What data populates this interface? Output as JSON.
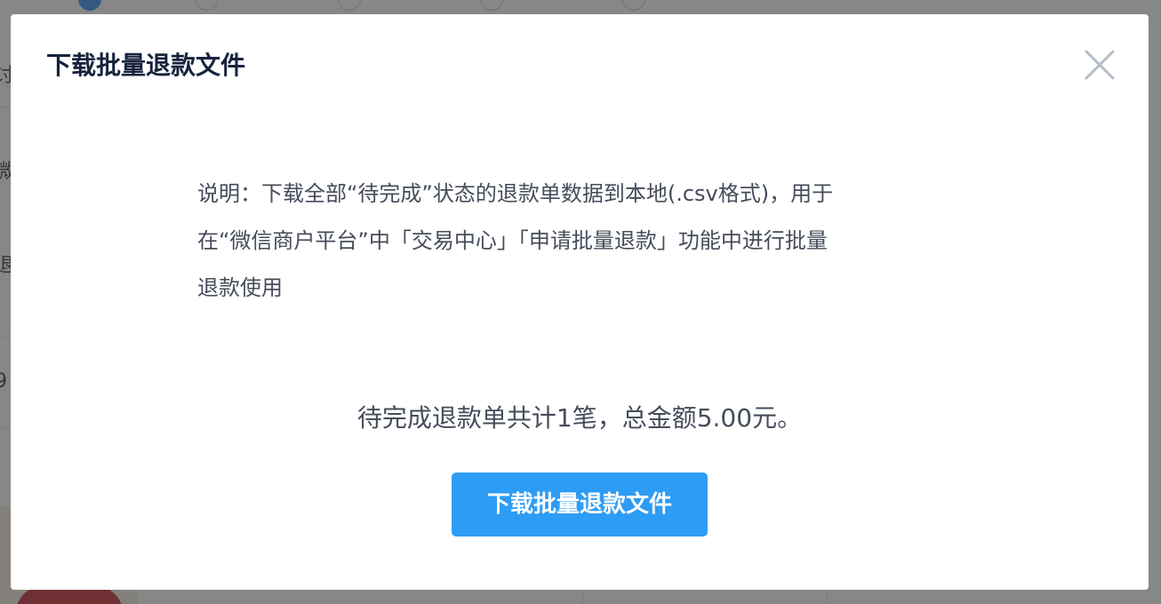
{
  "dialog": {
    "title": "下载批量退款文件",
    "close_icon": "close-icon",
    "description_lines": [
      "说明：下载全部“待完成”状态的退款单数据到本地(.csv格式)，用于",
      "在“微信商户平台”中「交易中心」「申请批量退款」功能中进行批量",
      "退款使用"
    ],
    "summary": "待完成退款单共计1笔，总金额5.00元。",
    "download_button_label": "下载批量退款文件"
  },
  "colors": {
    "primary": "#2d9cf5",
    "title_text": "#17233d",
    "body_text": "#464c5b",
    "overlay": "rgba(55,55,55,0.6)"
  }
}
